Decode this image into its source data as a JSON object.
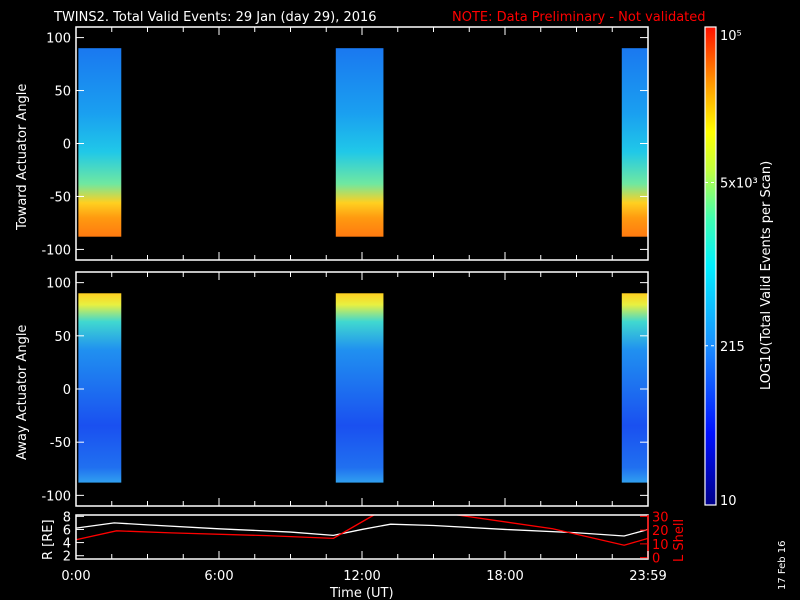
{
  "chart_data": {
    "type": "heatmap",
    "title": "TWINS2. Total Valid Events: 29 Jan (day  29), 2016",
    "note": "NOTE: Data Preliminary - Not validated",
    "date_stamp": "17 Feb 16",
    "xlabel": "Time (UT)",
    "x_ticks": [
      "0:00",
      "6:00",
      "12:00",
      "18:00",
      "23:59"
    ],
    "x_range_hours": [
      0,
      24
    ],
    "colorbar": {
      "label": "LOG10(Total Valid Events per Scan)",
      "ticks": [
        {
          "label": "10",
          "value": 10
        },
        {
          "label": "215",
          "value": 215
        },
        {
          "label": "5x10³",
          "value": 5000
        },
        {
          "label": "10⁵",
          "value": 100000
        }
      ],
      "range": [
        10,
        100000
      ],
      "scale": "log"
    },
    "panels": [
      {
        "ylabel": "Toward Actuator Angle",
        "yrange": [
          -110,
          110
        ],
        "y_ticks": [
          "100",
          "50",
          "0",
          "-50",
          "-100"
        ],
        "data_angle_range": [
          -88,
          90
        ],
        "pattern": "low at top (~200), rising to ~3e4 near -80",
        "segments_hours": [
          [
            0.1,
            1.9
          ],
          [
            10.9,
            12.9
          ],
          [
            22.9,
            24
          ]
        ]
      },
      {
        "ylabel": "Away Actuator Angle",
        "yrange": [
          -110,
          110
        ],
        "y_ticks": [
          "100",
          "50",
          "0",
          "-50",
          "-100"
        ],
        "data_angle_range": [
          -88,
          90
        ],
        "pattern": "high at top (~5e3), falling to ~100 at bottom",
        "segments_hours": [
          [
            0.1,
            1.9
          ],
          [
            10.9,
            12.9
          ],
          [
            22.9,
            24
          ]
        ]
      }
    ],
    "ephemeris": {
      "left_label": "R [RE]",
      "left_ticks": [
        "2",
        "4",
        "6",
        "8"
      ],
      "left_range": [
        1.5,
        8.2
      ],
      "right_label": "L Shell",
      "right_ticks": [
        "0",
        "10",
        "20",
        "30"
      ],
      "right_range": [
        -1,
        31
      ],
      "series": [
        {
          "name": "R",
          "color": "#ffffff",
          "x": [
            0,
            1.6,
            3,
            6,
            9,
            10.8,
            12,
            13.2,
            15,
            18,
            21,
            23,
            24
          ],
          "y": [
            6.2,
            7.0,
            6.7,
            6.1,
            5.6,
            5.1,
            6.0,
            6.8,
            6.6,
            6.0,
            5.5,
            5.0,
            6.0
          ]
        },
        {
          "name": "L Shell",
          "color": "#ff0000",
          "x": [
            0,
            1.7,
            4,
            8,
            10.8,
            12.5
          ],
          "y": [
            13,
            19.5,
            18,
            16,
            14,
            33
          ]
        },
        {
          "name": "L Shell (cont.)",
          "color": "#ff0000",
          "x": [
            16,
            20,
            23,
            24
          ],
          "y": [
            33,
            21,
            9,
            14
          ]
        }
      ]
    },
    "colors": {
      "note": "#ff0000",
      "axis": "#ffffff",
      "lshell": "#ff0000"
    }
  }
}
